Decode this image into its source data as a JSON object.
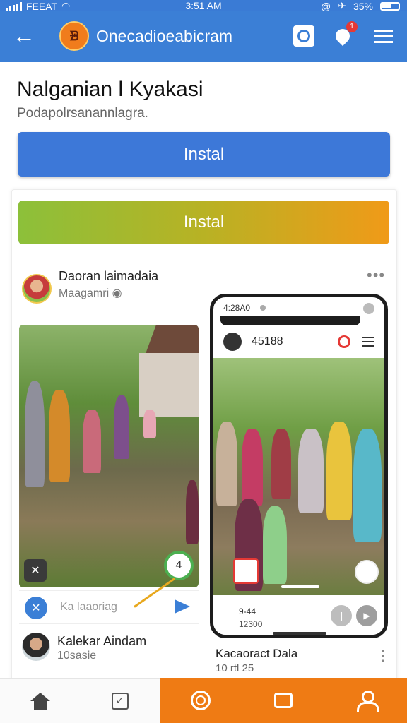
{
  "status": {
    "carrier": "FEEAT",
    "time": "3:51 AM",
    "battery": "35%"
  },
  "appbar": {
    "logo_text": "ᗾ",
    "title": "Onecadioeabicram"
  },
  "header": {
    "title": "Nalganian l Kyakasi",
    "subtitle": "Podapolrsanannlagra.",
    "install_label": "Instal"
  },
  "card": {
    "install_label": "Instal",
    "poster": {
      "name": "Daoran laimadaia",
      "sub": "Maagamri"
    },
    "left_post": {
      "pin_glyph": "✕",
      "badge_text": "4",
      "comment_placeholder": "Ka laaoriag"
    },
    "user": {
      "name": "Kalekar Aindam",
      "sub": "10sasie"
    },
    "phone": {
      "time": "4:28A0",
      "code": "45188",
      "footer_line1": "9-44",
      "footer_line2": "12300"
    },
    "caption": {
      "name": "Kacaoract Dala",
      "sub": "10 rtl 25"
    }
  },
  "colors": {
    "brand_blue": "#3b7fd6",
    "accent_orange": "#ef7b14",
    "gradient_green": "#8cc03a",
    "gradient_orange": "#f09a18"
  },
  "nav": [
    "home-icon",
    "checklist-icon",
    "target-icon",
    "chat-icon",
    "profile-icon"
  ]
}
